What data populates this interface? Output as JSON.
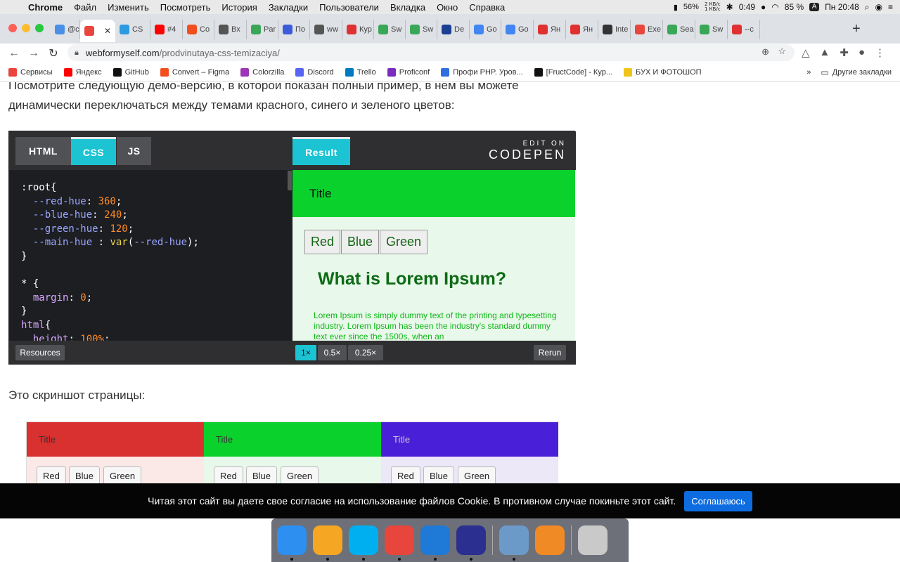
{
  "menubar": {
    "apple_icon": "apple-icon",
    "app": "Chrome",
    "items": [
      "Файл",
      "Изменить",
      "Посмотреть",
      "История",
      "Закладки",
      "Пользователи",
      "Вкладка",
      "Окно",
      "Справка"
    ],
    "cpu_percent": "56%",
    "net_up": "2 КБ/с",
    "net_down": "1 КБ/с",
    "battery_time": "0:49",
    "battery_percent": "85 %",
    "input_lang": "A",
    "clock": "Пн 20:48"
  },
  "tabs": [
    {
      "label": "@c",
      "color": "#4a8fe7"
    },
    {
      "label": "",
      "color": "#e8453c",
      "active": true
    },
    {
      "label": "CS",
      "color": "#2c9be0"
    },
    {
      "label": "#4",
      "color": "#ff0000"
    },
    {
      "label": "Co",
      "color": "#f24e1e"
    },
    {
      "label": "Вх",
      "color": "#555555"
    },
    {
      "label": "Par",
      "color": "#3aa757"
    },
    {
      "label": "По",
      "color": "#3b5bdb"
    },
    {
      "label": "ww",
      "color": "#555555"
    },
    {
      "label": "Кур",
      "color": "#e03131"
    },
    {
      "label": "Sw",
      "color": "#3aa757"
    },
    {
      "label": "Sw",
      "color": "#3aa757"
    },
    {
      "label": "De",
      "color": "#1c3f94"
    },
    {
      "label": "Go",
      "color": "#4285f4"
    },
    {
      "label": "Go",
      "color": "#4285f4"
    },
    {
      "label": "Ян",
      "color": "#e03131"
    },
    {
      "label": "Ян",
      "color": "#e03131"
    },
    {
      "label": "Inte",
      "color": "#333333"
    },
    {
      "label": "Exe",
      "color": "#e8453c"
    },
    {
      "label": "Sea",
      "color": "#3aa757"
    },
    {
      "label": "Sw",
      "color": "#3aa757"
    },
    {
      "label": "--c",
      "color": "#e03131"
    }
  ],
  "address": {
    "host": "webformyself.com",
    "path": "/prodvinutaya-css-temizaciya/"
  },
  "bookmarks": [
    {
      "label": "Сервисы",
      "color": "#e8453c"
    },
    {
      "label": "Яндекс",
      "color": "#ff0000"
    },
    {
      "label": "GitHub",
      "color": "#111111"
    },
    {
      "label": "Convert – Figma",
      "color": "#f24e1e"
    },
    {
      "label": "Colorzilla",
      "color": "#9c36b5"
    },
    {
      "label": "Discord",
      "color": "#5865f2"
    },
    {
      "label": "Trello",
      "color": "#0079bf"
    },
    {
      "label": "Proficonf",
      "color": "#7b2cbf"
    },
    {
      "label": "Профи PHP. Уров...",
      "color": "#2f6fdf"
    },
    {
      "label": "[FructCode] - Кур...",
      "color": "#111111"
    },
    {
      "label": "БУХ И ФОТОШОП",
      "color": "#f0c419"
    }
  ],
  "bookmarks_more": "»",
  "bookmarks_other": "Другие закладки",
  "article": {
    "intro_line1": "Посмотрите следующую демо-версию, в которой показан полный пример, в нем вы можете",
    "intro_line2": "динамически переключаться между темами красного, синего и зеленого цветов:",
    "screenshot_caption": "Это скриншот страницы:"
  },
  "codepen": {
    "tabs": [
      "HTML",
      "CSS",
      "JS"
    ],
    "active_tab": "CSS",
    "result_tab": "Result",
    "edit_on": "EDIT ON",
    "brand": "CODEPEN",
    "result_title": "Title",
    "result_buttons": [
      "Red",
      "Blue",
      "Green"
    ],
    "result_heading": "What is Lorem Ipsum?",
    "result_text": "Lorem Ipsum is simply dummy text of the printing and typesetting industry. Lorem Ipsum has been the industry's standard dummy text ever since the 1500s, when an",
    "resources": "Resources",
    "zoom": [
      "1×",
      "0.5×",
      "0.25×"
    ],
    "active_zoom": "1×",
    "rerun": "Rerun"
  },
  "preview_columns": [
    {
      "title": "Title",
      "header": "#d93030",
      "body": "#fbe9e8",
      "buttons": [
        "Red",
        "Blue",
        "Green"
      ],
      "text": "#333333"
    },
    {
      "title": "Title",
      "header": "#0bd12d",
      "body": "#e8f8ea",
      "buttons": [
        "Red",
        "Blue",
        "Green"
      ],
      "text": "#333333"
    },
    {
      "title": "Title",
      "header": "#4a1fd8",
      "body": "#ece8f8",
      "buttons": [
        "Red",
        "Blue",
        "Green"
      ],
      "text": "#cccccc"
    }
  ],
  "cookie": {
    "text": "Читая этот сайт вы даете свое согласие на использование файлов Cookie. В противном случае покиньте этот сайт.",
    "button": "Соглашаюсь"
  },
  "dock": [
    {
      "name": "finder-icon",
      "color": "#2d8ff0"
    },
    {
      "name": "pages-icon",
      "color": "#f5a623"
    },
    {
      "name": "skype-icon",
      "color": "#00aff0"
    },
    {
      "name": "chrome-icon",
      "color": "#e8453c"
    },
    {
      "name": "vscode-icon",
      "color": "#1e7ad6"
    },
    {
      "name": "app-icon",
      "color": "#2b2f8f"
    },
    {
      "name": "preview-icon",
      "color": "#6c9ac8"
    },
    {
      "name": "calculator-icon",
      "color": "#f08a24"
    },
    {
      "name": "trash-icon",
      "color": "#c9c9c9"
    }
  ],
  "colors": {
    "codepen_accent": "#1bc3d3",
    "cookie_button": "#0d6de0"
  }
}
